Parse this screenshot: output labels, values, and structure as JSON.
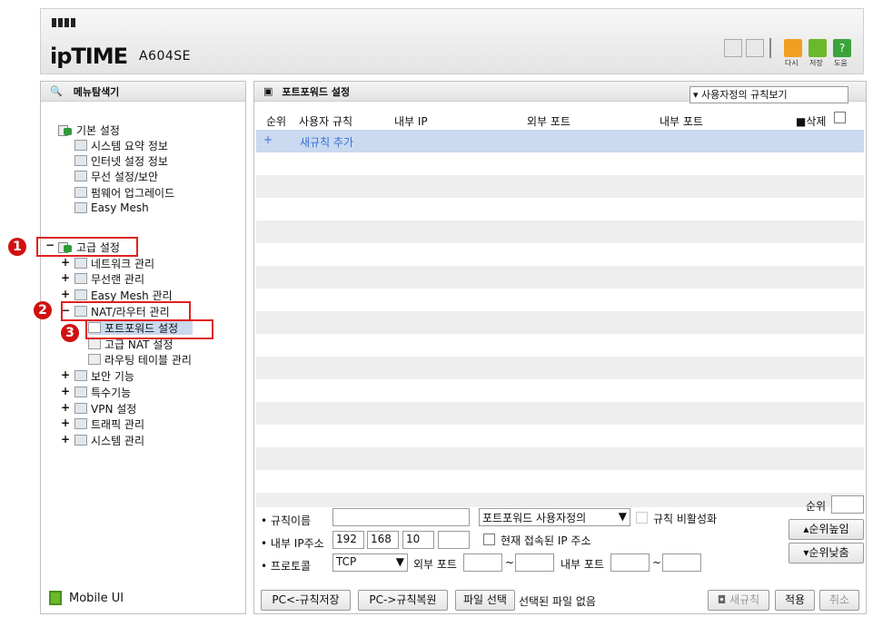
{
  "header": {
    "logo_text": "ipTIME",
    "model": "A604SE",
    "buttons": [
      {
        "label": "다시"
      },
      {
        "label": "저장"
      },
      {
        "label": "도움"
      }
    ]
  },
  "left": {
    "title": "메뉴탐색기",
    "basic": {
      "label": "기본 설정",
      "items": [
        "시스템 요약 정보",
        "인터넷 설정 정보",
        "무선 설정/보안",
        "펌웨어 업그레이드",
        "Easy Mesh"
      ]
    },
    "advanced": {
      "label": "고급 설정",
      "items": [
        "네트워크 관리",
        "무선랜 관리",
        "Easy Mesh 관리",
        "NAT/라우터 관리"
      ],
      "nat_sub": [
        "포트포워드 설정",
        "고급 NAT 설정",
        "라우팅 테이블 관리"
      ],
      "more": [
        "보안 기능",
        "특수기능",
        "VPN 설정",
        "트래픽 관리",
        "시스템 관리"
      ]
    },
    "mobile": "Mobile UI",
    "badges": [
      "1",
      "2",
      "3"
    ]
  },
  "right": {
    "title": "포트포워드 설정",
    "view_select": "사용자정의 규칙보기",
    "columns": [
      "순위",
      "사용자 규칙",
      "내부 IP",
      "외부 포트",
      "내부 포트",
      "삭제"
    ],
    "new_rule_plus": "+",
    "new_rule": "새규칙 추가",
    "form": {
      "rule_name_label": "규칙이름",
      "rule_name": "",
      "rule_type": "포트포워드 사용자정의",
      "disable_label": "규칙 비활성화",
      "ip_label": "내부 IP주소",
      "ip": [
        "192",
        "168",
        "10",
        ""
      ],
      "current_ip_label": "현재 접속된 IP 주소",
      "proto_label": "프로토콜",
      "protocol": "TCP",
      "ext_port_label": "외부 포트",
      "int_port_label": "내부 포트",
      "tilde": "~",
      "rank_label": "순위",
      "rank_up": "순위높임",
      "rank_down": "순위낮춤"
    },
    "buttons": {
      "save": "PC<-규칙저장",
      "restore": "PC->규칙복원",
      "file": "파일 선택",
      "no_file": "선택된 파일 없음",
      "new_rule": "새규칙",
      "apply": "적용",
      "cancel": "취소"
    }
  }
}
